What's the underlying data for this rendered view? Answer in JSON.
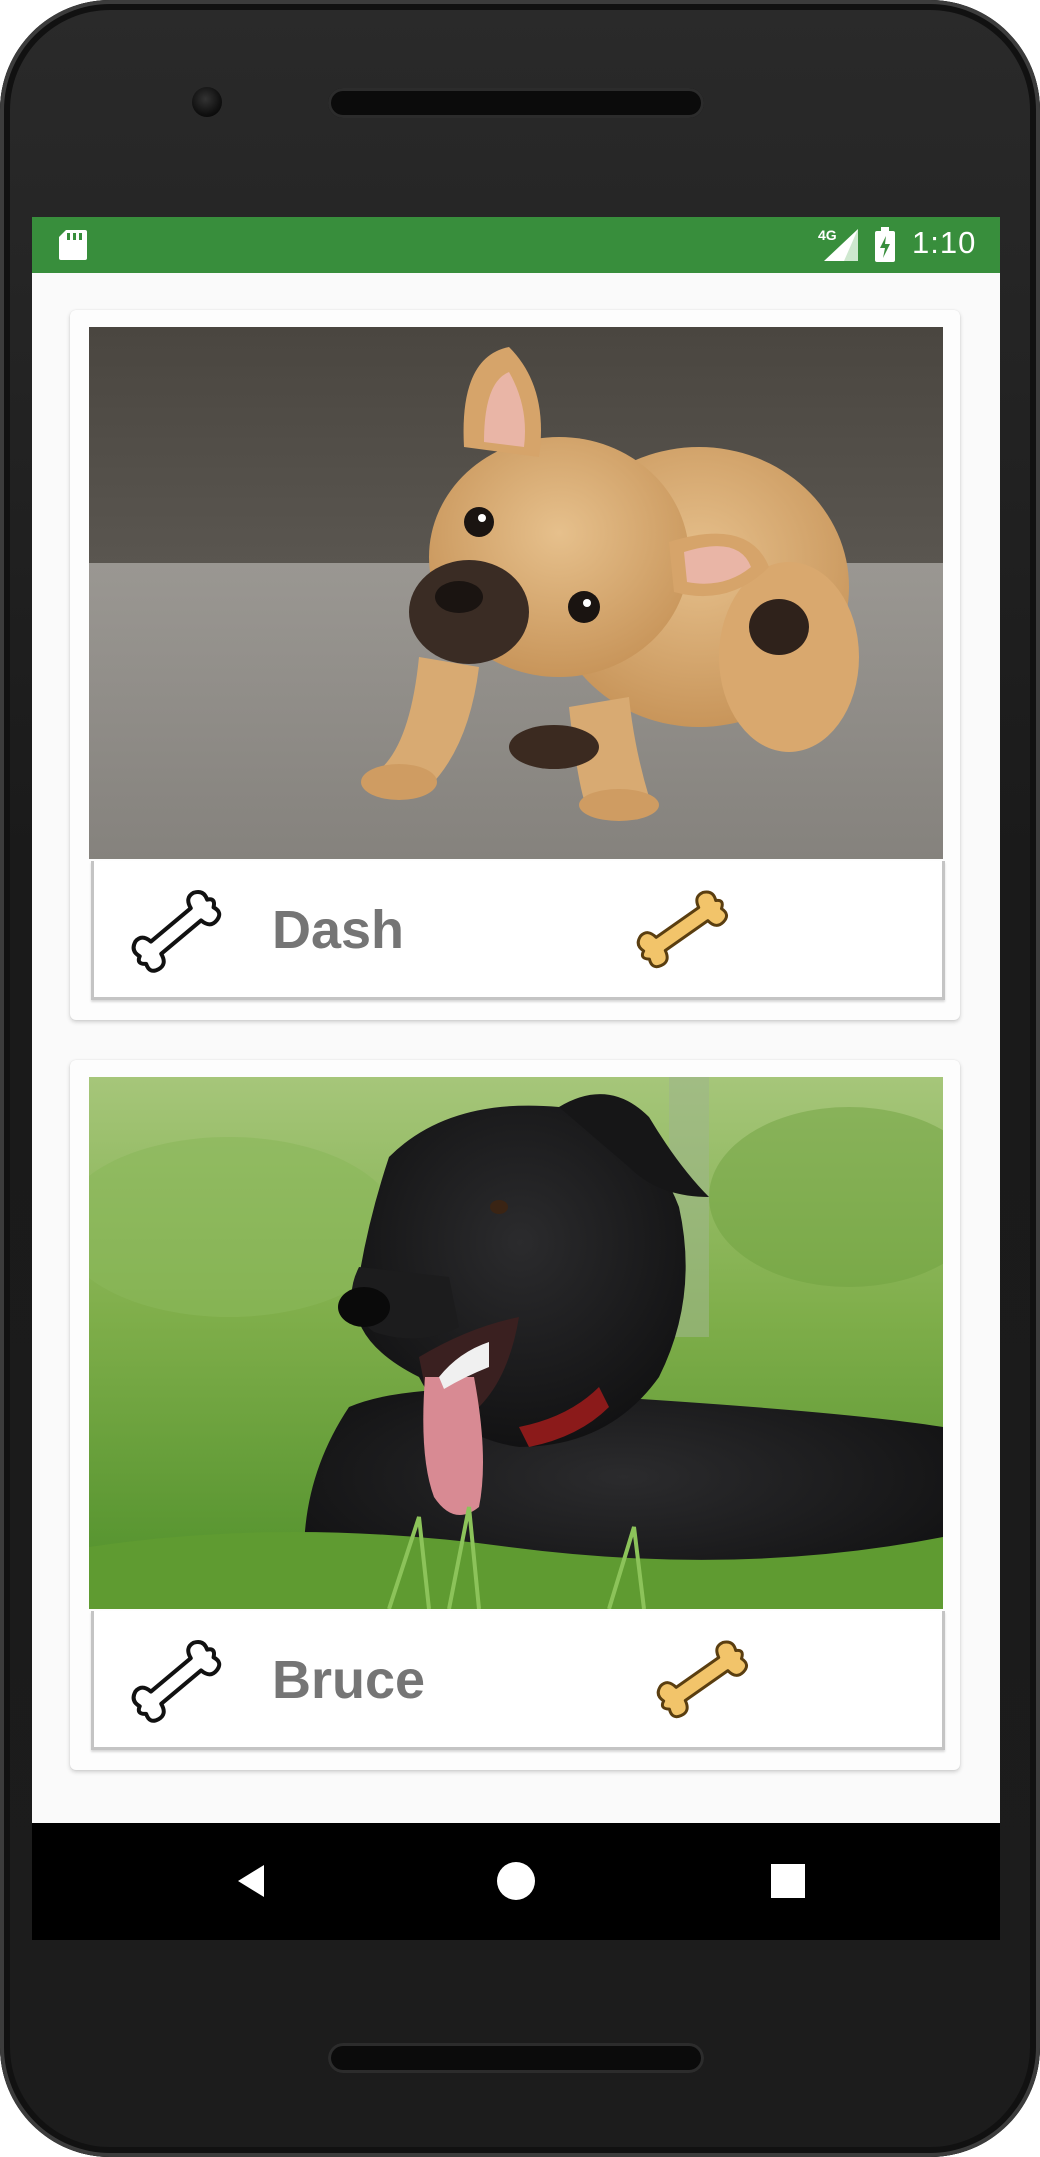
{
  "status_bar": {
    "background": "#388e3c",
    "time": "1:10",
    "network_label": "4G",
    "icons": [
      "sd-card-icon",
      "signal-icon",
      "battery-icon"
    ]
  },
  "cards": [
    {
      "name": "Dash",
      "image": "french bulldog puppy scratching on grey floor",
      "left_icon": "bone-outline-icon",
      "right_icon": "bone-filled-icon"
    },
    {
      "name": "Bruce",
      "image": "black shaggy dog lying in green grass",
      "left_icon": "bone-outline-icon",
      "right_icon": "bone-filled-icon"
    }
  ],
  "nav_bar": {
    "buttons": [
      "back-icon",
      "home-icon",
      "recents-icon"
    ]
  },
  "colors": {
    "accent": "#388e3c",
    "name_text": "#757575",
    "bone_fill": "#f2c46a"
  }
}
